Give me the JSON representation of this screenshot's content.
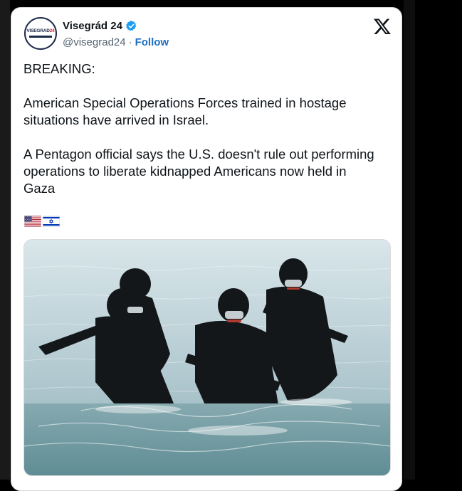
{
  "account": {
    "name": "Visegrád 24",
    "handle": "@visegrad24",
    "separator": "·",
    "follow_label": "Follow",
    "avatar_logo_main": "VISEGRAD",
    "avatar_logo_num": "24"
  },
  "tweet": {
    "paragraphs": [
      "BREAKING:",
      "American Special Operations Forces trained in hostage situations have arrived in Israel.",
      "A Pentagon official says the U.S. doesn't rule out performing operations to liberate kidnapped Americans now held in Gaza"
    ],
    "flags": [
      "us-flag",
      "israel-flag"
    ]
  },
  "icons": {
    "verified": "verified-badge-icon",
    "platform": "x-logo-icon"
  },
  "colors": {
    "link": "#1d6fc4",
    "verified": "#1d9bf0",
    "text": "#0f1419",
    "secondary": "#536471",
    "background": "#000000"
  }
}
